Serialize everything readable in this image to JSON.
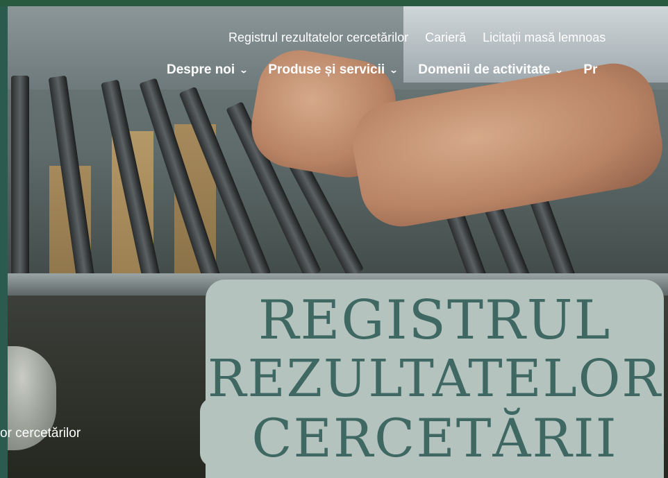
{
  "nav_top": {
    "items": [
      "Registrul rezultatelor cercetărilor",
      "Carieră",
      "Licitații masă lemnoas"
    ]
  },
  "nav_main": {
    "items": [
      {
        "label": "Despre noi",
        "icon": "chevron-down-icon"
      },
      {
        "label": "Produse și servicii",
        "icon": "chevron-down-icon"
      },
      {
        "label": "Domenii de activitate",
        "icon": "chevron-down-icon"
      },
      {
        "label": "Pr"
      }
    ]
  },
  "breadcrumb": {
    "text": "or cercetărilor"
  },
  "hero_title": {
    "lines": [
      "REGISTRUL",
      "REZULTATELOR",
      "CERCETĂRII"
    ],
    "box_color": "#b5c3bf",
    "text_color": "#3f6862"
  },
  "colors": {
    "accent": "#275a3e"
  }
}
